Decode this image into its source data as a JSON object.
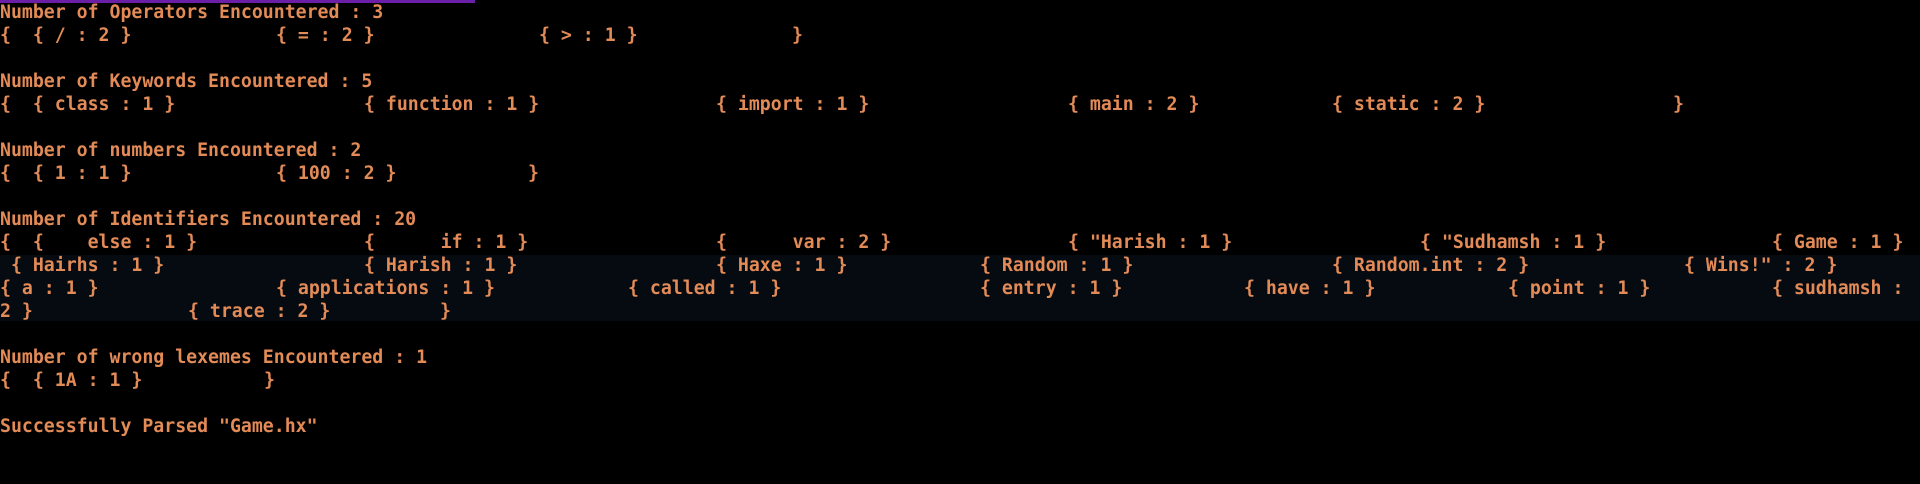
{
  "terminal": {
    "accent_color": "#e38b57",
    "background_color": "#000000",
    "operators": {
      "header": "Number of Operators Encountered : 3",
      "entries": [
        "{  { / : 2 }",
        "{ = : 2 }",
        "{ > : 1 }",
        "}"
      ]
    },
    "keywords": {
      "header": "Number of Keywords Encountered : 5",
      "entries": [
        "{  { class : 1 }",
        "{ function : 1 }",
        "{ import : 1 }",
        "{ main : 2 }",
        "{ static : 2 }",
        "}"
      ]
    },
    "numbers": {
      "header": "Number of numbers Encountered : 2",
      "entries": [
        "{  { 1 : 1 }",
        "{ 100 : 2 }",
        "}"
      ]
    },
    "identifiers": {
      "header": "Number of Identifiers Encountered : 20",
      "row1": [
        "{  {    else : 1 }",
        "{      if : 1 }",
        "{      var : 2 }",
        "{ \"Harish : 1 }",
        "{ \"Sudhamsh : 1 }",
        "{ Game : 1 }"
      ],
      "row2": [
        " { Hairhs : 1 }",
        "{ Harish : 1 }",
        "{ Haxe : 1 }",
        "{ Random : 1 }",
        "{ Random.int : 2 }",
        "{ Wins!\" : 2 }"
      ],
      "row3": [
        "{ a : 1 }",
        "{ applications : 1 }",
        "{ called : 1 }",
        "{ entry : 1 }",
        "{ have : 1 }",
        "{ point : 1 }",
        "{ sudhamsh :"
      ],
      "row4": [
        "2 }",
        "{ trace : 2 }",
        "}"
      ]
    },
    "wrong_lexemes": {
      "header": "Number of wrong lexemes Encountered : 1",
      "entries": [
        "{  { 1A : 1 }",
        "}"
      ]
    },
    "status": "Successfully Parsed \"Game.hx\""
  }
}
